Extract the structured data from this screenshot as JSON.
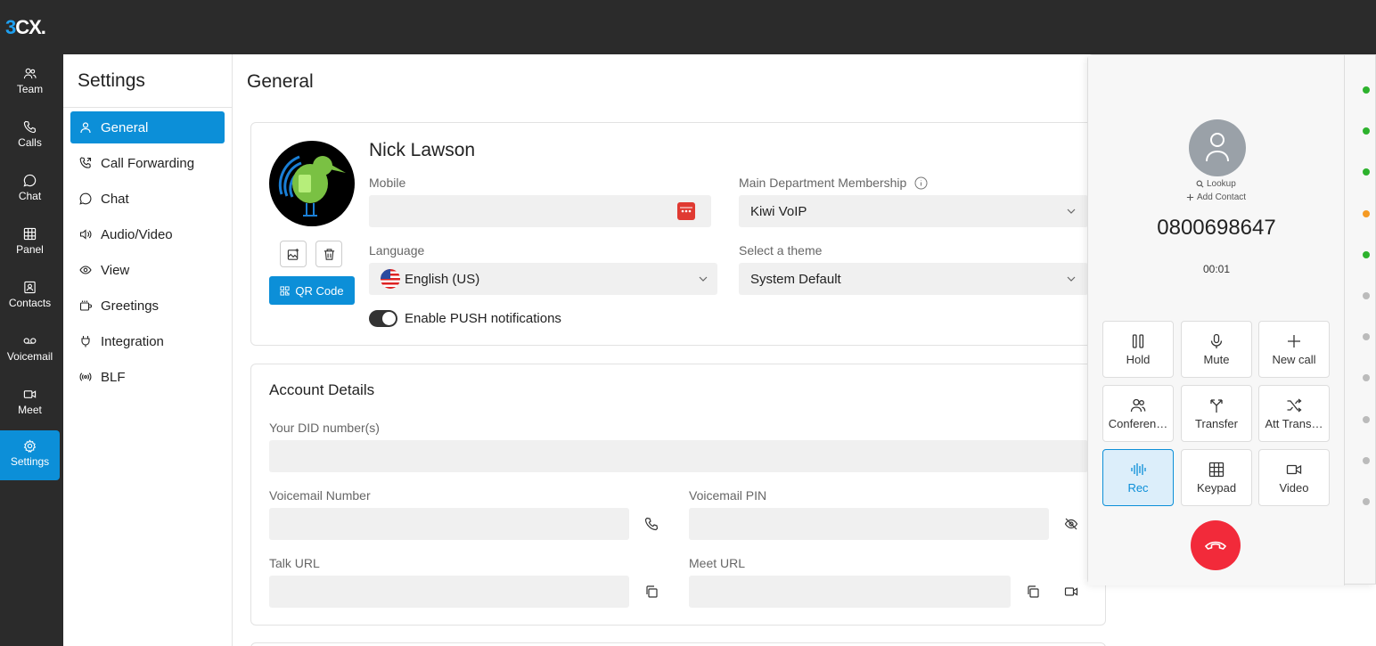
{
  "app": {
    "logo_prefix": "3",
    "logo_suffix": "CX."
  },
  "nav": {
    "items": [
      {
        "label": "Team",
        "icon": "team-icon"
      },
      {
        "label": "Calls",
        "icon": "phone-icon"
      },
      {
        "label": "Chat",
        "icon": "chat-icon"
      },
      {
        "label": "Panel",
        "icon": "grid-icon"
      },
      {
        "label": "Contacts",
        "icon": "contacts-icon"
      },
      {
        "label": "Voicemail",
        "icon": "voicemail-icon"
      },
      {
        "label": "Meet",
        "icon": "video-icon"
      },
      {
        "label": "Settings",
        "icon": "gear-icon",
        "active": true
      }
    ]
  },
  "settings": {
    "title": "Settings",
    "items": [
      {
        "label": "General",
        "active": true
      },
      {
        "label": "Call Forwarding"
      },
      {
        "label": "Chat"
      },
      {
        "label": "Audio/Video"
      },
      {
        "label": "View"
      },
      {
        "label": "Greetings"
      },
      {
        "label": "Integration"
      },
      {
        "label": "BLF"
      }
    ]
  },
  "main": {
    "title": "General",
    "profile": {
      "name": "Nick Lawson",
      "qr_label": "QR Code",
      "mobile_label": "Mobile",
      "mobile_value": "",
      "department_label": "Main Department Membership",
      "department_value": "Kiwi VoIP",
      "language_label": "Language",
      "language_value": "English (US)",
      "theme_label": "Select a theme",
      "theme_value": "System Default",
      "push_label": "Enable PUSH notifications",
      "push_enabled": true
    },
    "account": {
      "title": "Account Details",
      "did_label": "Your DID number(s)",
      "voicemail_number_label": "Voicemail Number",
      "voicemail_pin_label": "Voicemail PIN",
      "talk_url_label": "Talk URL",
      "meet_url_label": "Meet URL"
    }
  },
  "call": {
    "lookup": "Lookup",
    "add_contact": "Add Contact",
    "number": "0800698647",
    "timer": "00:01",
    "buttons": [
      {
        "label": "Hold",
        "icon": "pause-icon"
      },
      {
        "label": "Mute",
        "icon": "microphone-icon"
      },
      {
        "label": "New call",
        "icon": "plus-icon"
      },
      {
        "label": "Conferen…",
        "icon": "conference-icon"
      },
      {
        "label": "Transfer",
        "icon": "transfer-icon"
      },
      {
        "label": "Att Trans…",
        "icon": "shuffle-icon"
      },
      {
        "label": "Rec",
        "icon": "waveform-icon",
        "active": true
      },
      {
        "label": "Keypad",
        "icon": "keypad-icon"
      },
      {
        "label": "Video",
        "icon": "video-icon"
      }
    ],
    "status_dots": [
      "#2db22d",
      "#2db22d",
      "#2db22d",
      "#f59a23",
      "#2db22d",
      "#bbbbbb",
      "#bbbbbb",
      "#bbbbbb",
      "#bbbbbb",
      "#bbbbbb",
      "#bbbbbb"
    ]
  },
  "colors": {
    "accent": "#0c8fd8",
    "sidebar": "#2b2b2b",
    "hangup": "#f22a3a"
  }
}
